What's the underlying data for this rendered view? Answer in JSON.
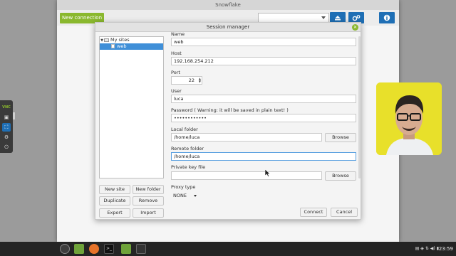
{
  "app": {
    "title": "Snowflake",
    "new_connection_label": "New connection"
  },
  "dialog": {
    "title": "Session manager",
    "tree": {
      "root_label": "My sites",
      "child_label": "web"
    },
    "left_buttons": {
      "new_site": "New site",
      "new_folder": "New folder",
      "duplicate": "Duplicate",
      "remove": "Remove",
      "export": "Export",
      "import": "Import"
    },
    "fields": {
      "name": {
        "label": "Name",
        "value": "web"
      },
      "host": {
        "label": "Host",
        "value": "192.168.254.212"
      },
      "port": {
        "label": "Port",
        "value": "22"
      },
      "user": {
        "label": "User",
        "value": "luca"
      },
      "password": {
        "label": "Password ( Warning: it will be saved in plain text! )",
        "value": "••••••••••••"
      },
      "local_folder": {
        "label": "Local folder",
        "value": "/home/luca"
      },
      "remote_folder": {
        "label": "Remote folder",
        "value": "/home/luca"
      },
      "private_key": {
        "label": "Private key file",
        "value": ""
      },
      "proxy_type": {
        "label": "Proxy type",
        "value": "NONE"
      }
    },
    "browse_label": "Browse",
    "connect_label": "Connect",
    "cancel_label": "Cancel"
  },
  "dock": {
    "vnc_label": "VNC"
  },
  "taskbar": {
    "clock": "23:59"
  },
  "colors": {
    "accent_green": "#8ab82e",
    "accent_blue": "#1f6fb5",
    "selection_blue": "#3f8fd8",
    "webcam_bg": "#e8e02a"
  }
}
